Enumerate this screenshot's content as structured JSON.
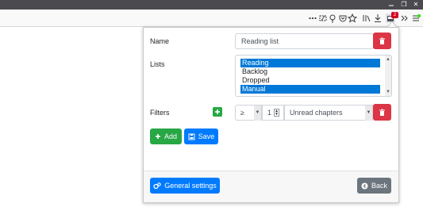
{
  "window": {
    "restore_glyph": "❐",
    "close_glyph": "✕"
  },
  "toolbar": {
    "badge_count": "2"
  },
  "form": {
    "name_label": "Name",
    "name_value": "Reading list",
    "lists_label": "Lists",
    "lists": [
      {
        "label": "Reading",
        "selected": true
      },
      {
        "label": "Backlog",
        "selected": false
      },
      {
        "label": "Dropped",
        "selected": false
      },
      {
        "label": "Manual",
        "selected": true
      }
    ],
    "filters_label": "Filters",
    "filter": {
      "operator": "≥",
      "number": "1",
      "field": "Unread chapters"
    },
    "add_label": "Add",
    "save_label": "Save"
  },
  "footer": {
    "general_settings_label": "General settings",
    "back_label": "Back"
  },
  "colors": {
    "danger": "#dc3545",
    "success": "#28a745",
    "primary": "#007bff",
    "secondary": "#6c757d",
    "selection": "#0078d7"
  }
}
